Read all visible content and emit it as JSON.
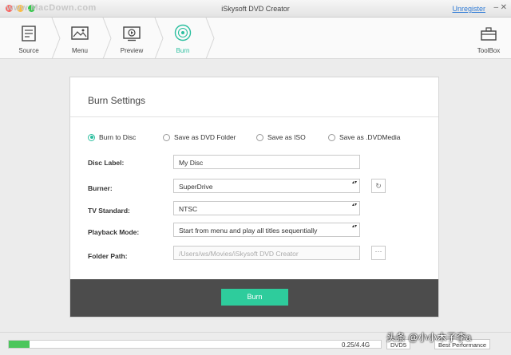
{
  "window": {
    "title": "iSkysoft DVD Creator",
    "watermark": "www.MacDown.com",
    "unregister_label": "Unregister"
  },
  "steps": [
    {
      "label": "Source",
      "icon": "source-icon"
    },
    {
      "label": "Menu",
      "icon": "menu-icon"
    },
    {
      "label": "Preview",
      "icon": "preview-icon"
    },
    {
      "label": "Burn",
      "icon": "burn-disc-icon",
      "active": true
    }
  ],
  "toolbox": {
    "label": "ToolBox",
    "icon": "toolbox-icon"
  },
  "burn_settings": {
    "title": "Burn Settings",
    "output_options": [
      {
        "label": "Burn to Disc",
        "selected": true
      },
      {
        "label": "Save as DVD Folder",
        "selected": false
      },
      {
        "label": "Save as ISO",
        "selected": false
      },
      {
        "label": "Save as .DVDMedia",
        "selected": false
      }
    ],
    "disc_label": {
      "label": "Disc Label:",
      "value": "My Disc"
    },
    "burner": {
      "label": "Burner:",
      "value": "SuperDrive"
    },
    "tv_standard": {
      "label": "TV Standard:",
      "value": "NTSC"
    },
    "playback_mode": {
      "label": "Playback Mode:",
      "value": "Start from menu and play all titles sequentially"
    },
    "folder_path": {
      "label": "Folder Path:",
      "value": "/Users/ws/Movies/iSkysoft DVD Creator"
    },
    "burn_button": "Burn"
  },
  "status": {
    "progress_fraction": 0.055,
    "capacity": "0.25/4.4G",
    "disc_type": "DVD5",
    "quality": "Best Performance"
  },
  "overlay_text": "头条 @小小木子李a",
  "colors": {
    "accent": "#2bbf9f",
    "burn_button": "#2ecc9c",
    "progress": "#4cc65c",
    "footer": "#4c4c4c"
  }
}
